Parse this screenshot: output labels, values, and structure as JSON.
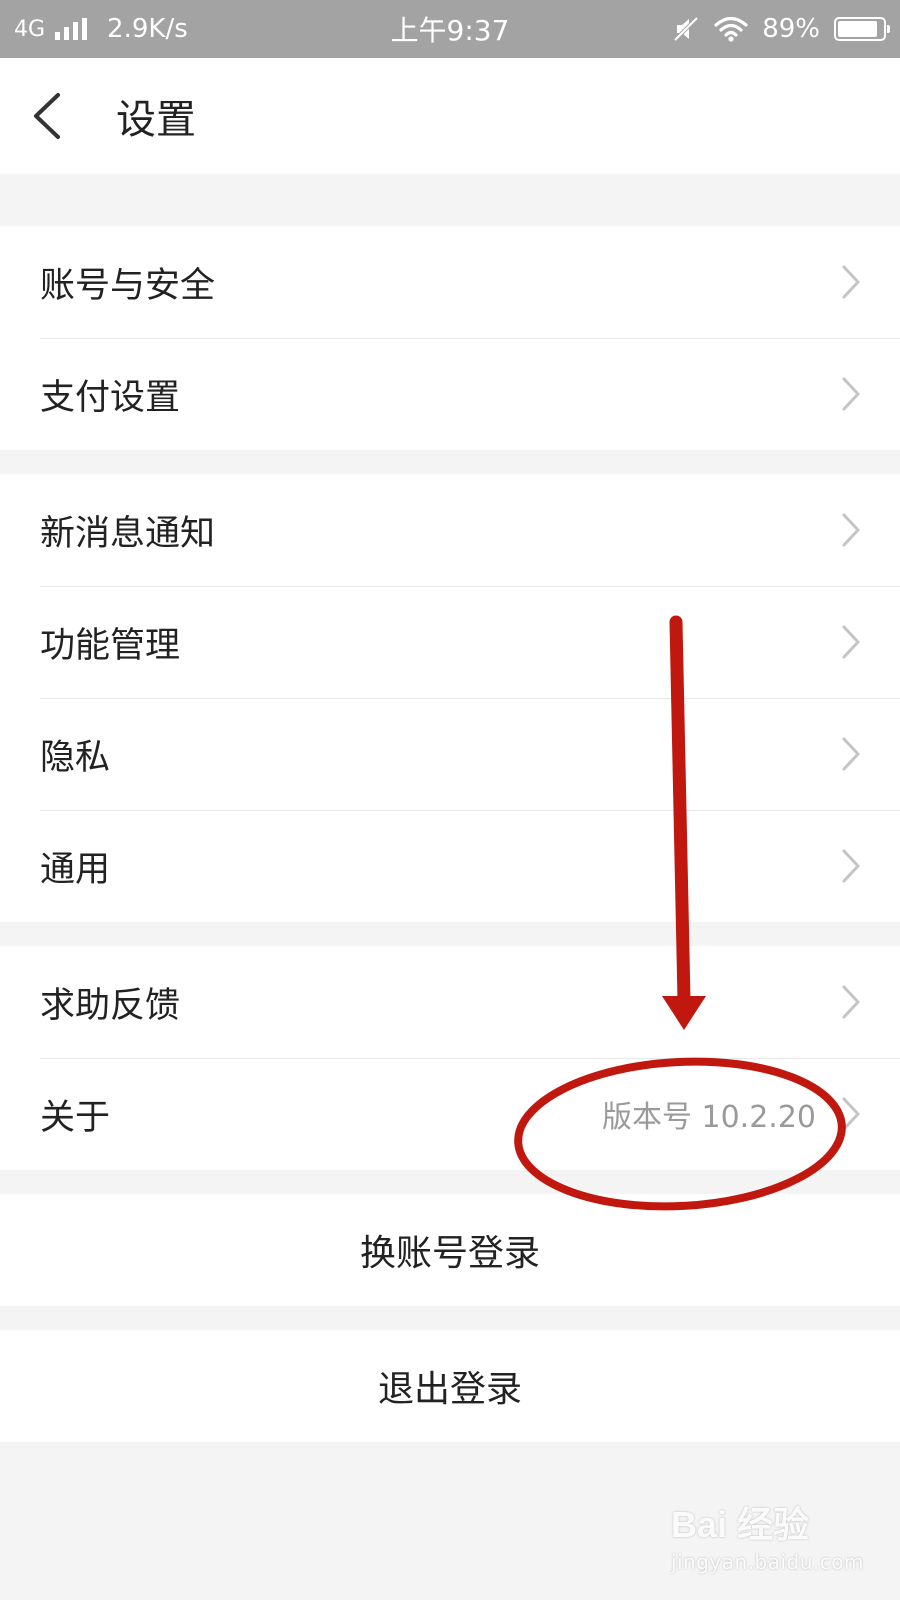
{
  "status_bar": {
    "network": "4G",
    "speed": "2.9K/s",
    "time": "上午9:37",
    "battery": "89%",
    "battery_level": 0.89
  },
  "nav": {
    "title": "设置",
    "back_icon": "chevron-left-icon"
  },
  "groups": [
    {
      "items": [
        {
          "label": "账号与安全"
        },
        {
          "label": "支付设置"
        }
      ]
    },
    {
      "items": [
        {
          "label": "新消息通知"
        },
        {
          "label": "功能管理"
        },
        {
          "label": "隐私"
        },
        {
          "label": "通用"
        }
      ]
    },
    {
      "items": [
        {
          "label": "求助反馈"
        },
        {
          "label": "关于",
          "value": "版本号 10.2.20"
        }
      ]
    }
  ],
  "actions": {
    "switch_account": "换账号登录",
    "logout": "退出登录"
  },
  "annotation": {
    "color": "#c0180f"
  },
  "watermark": {
    "logo": "Bai 经验",
    "url": "jingyan.baidu.com"
  }
}
